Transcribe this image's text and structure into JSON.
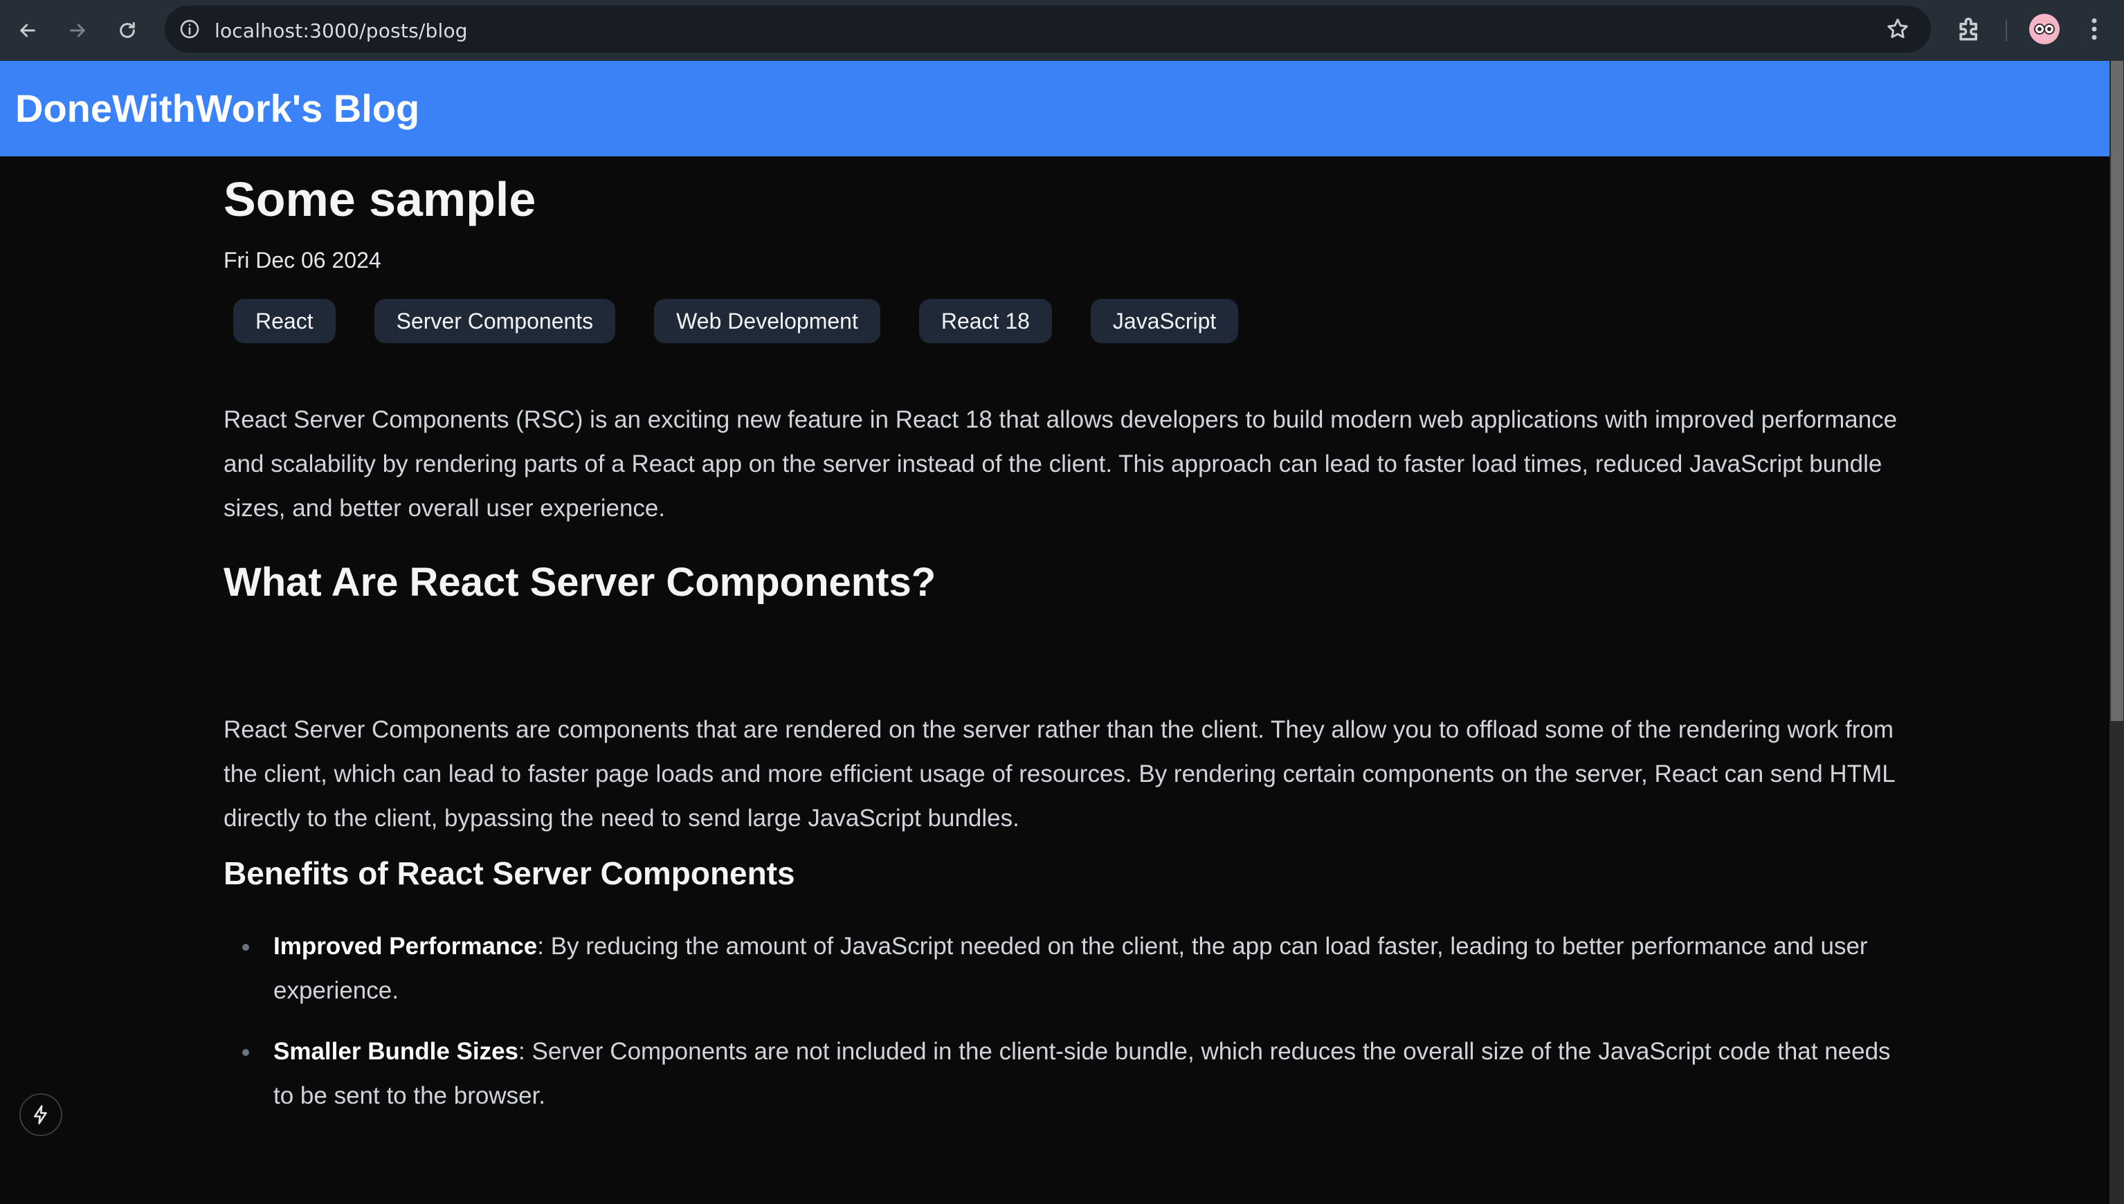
{
  "browser": {
    "url": "localhost:3000/posts/blog",
    "icons": {
      "back": "arrow-left-icon",
      "forward": "arrow-right-icon",
      "reload": "reload-icon",
      "site_info": "info-icon",
      "bookmark": "star-icon",
      "extensions": "puzzle-icon",
      "menu": "kebab-menu-icon"
    }
  },
  "site": {
    "title": "DoneWithWork's Blog",
    "header_color": "#3b82f6"
  },
  "post": {
    "title": "Some sample",
    "date": "Fri Dec 06 2024",
    "tags": [
      "React",
      "Server Components",
      "Web Development",
      "React 18",
      "JavaScript"
    ],
    "intro": "React Server Components (RSC) is an exciting new feature in React 18 that allows developers to build modern web applications with improved performance and scalability by rendering parts of a React app on the server instead of the client. This approach can lead to faster load times, reduced JavaScript bundle sizes, and better overall user experience.",
    "section1": {
      "heading": "What Are React Server Components?",
      "body": "React Server Components are components that are rendered on the server rather than the client. They allow you to offload some of the rendering work from the client, which can lead to faster page loads and more efficient usage of resources. By rendering certain components on the server, React can send HTML directly to the client, bypassing the need to send large JavaScript bundles."
    },
    "section2": {
      "heading": "Benefits of React Server Components",
      "items": [
        {
          "term": "Improved Performance",
          "text": ": By reducing the amount of JavaScript needed on the client, the app can load faster, leading to better performance and user experience."
        },
        {
          "term": "Smaller Bundle Sizes",
          "text": ": Server Components are not included in the client-side bundle, which reduces the overall size of the JavaScript code that needs to be sent to the browser."
        }
      ]
    }
  },
  "dev_indicator": {
    "icon": "lightning-icon"
  }
}
